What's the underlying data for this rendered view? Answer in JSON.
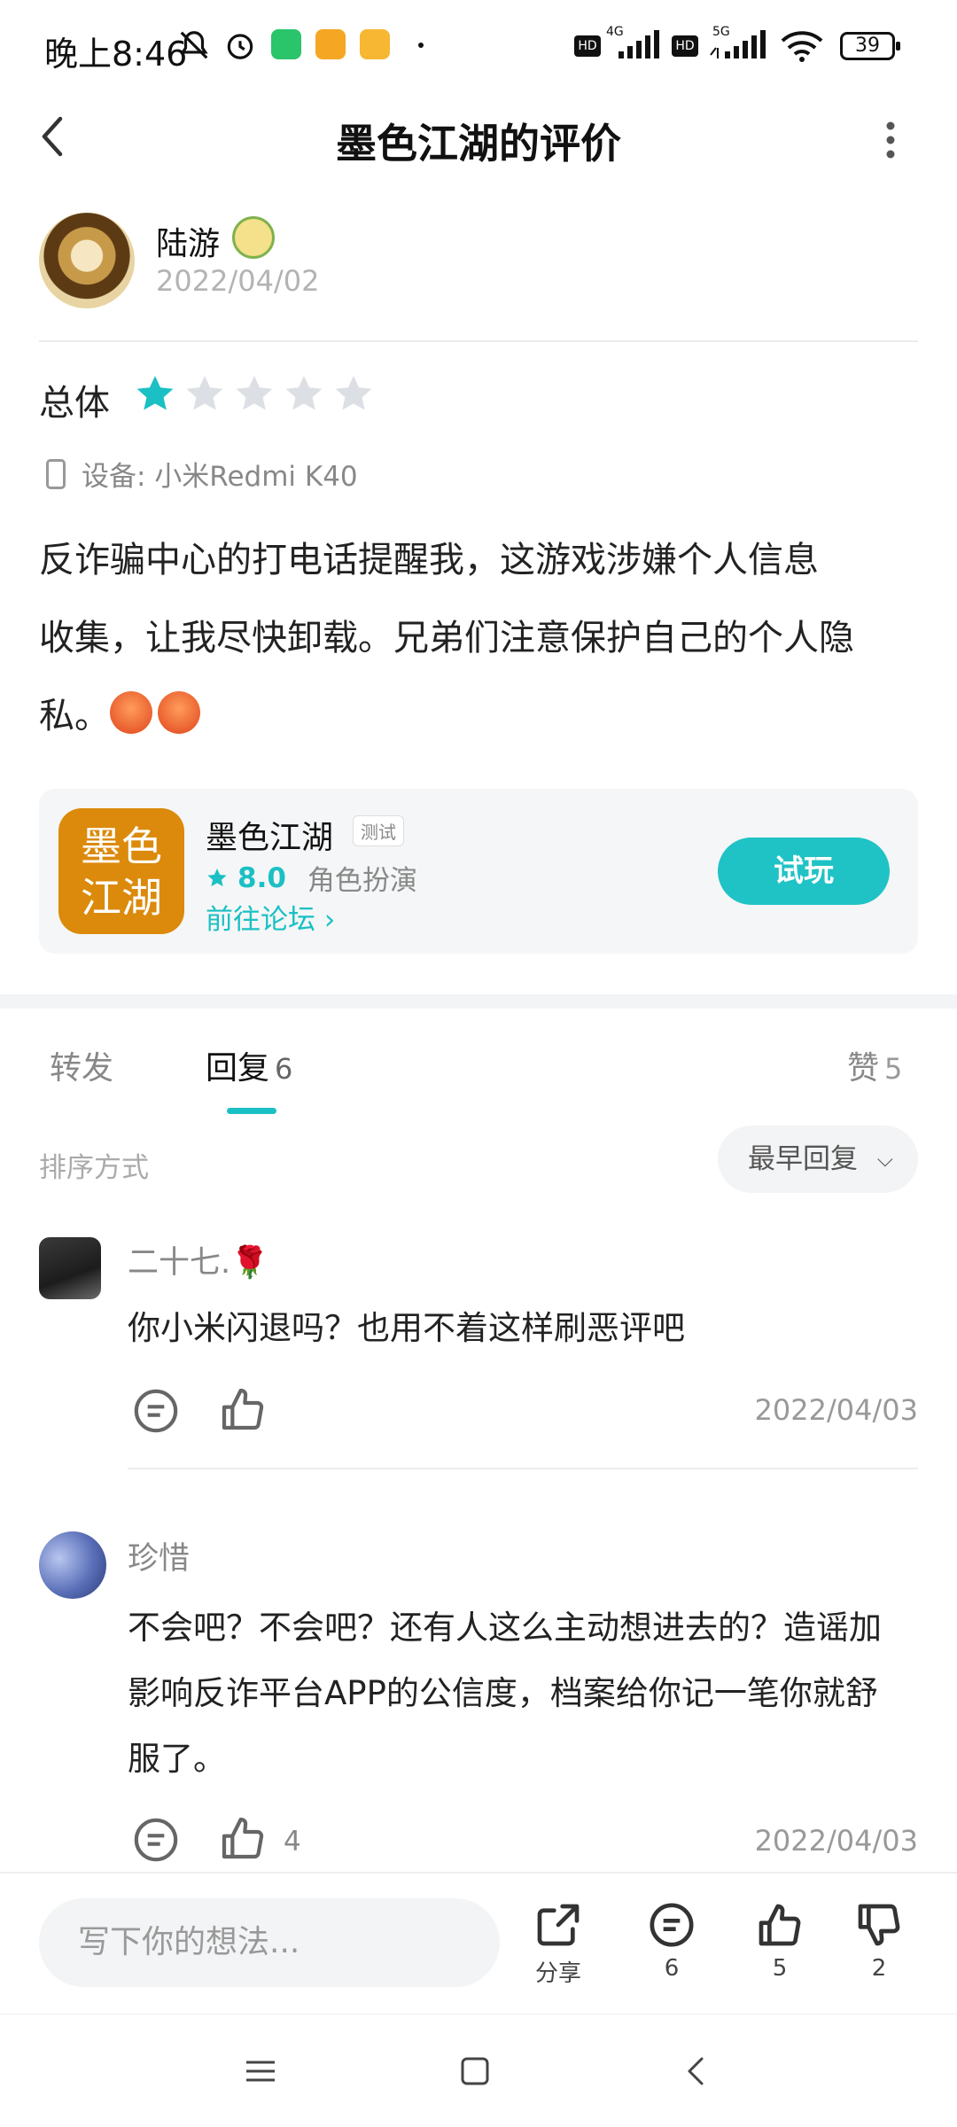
{
  "status_bar": {
    "time": "晚上8:46",
    "network_1": "4G",
    "network_2": "5G",
    "hd": "HD",
    "battery": "39"
  },
  "header": {
    "title": "墨色江湖的评价"
  },
  "review": {
    "username": "陆游",
    "date": "2022/04/02",
    "overall_label": "总体",
    "rating": 1,
    "max_rating": 5,
    "device_label": "设备: 小米Redmi K40",
    "text_line1": "反诈骗中心的打电话提醒我，这游戏涉嫌个人信息",
    "text_line2": "收集，让我尽快卸载。兄弟们注意保护自己的个人隐",
    "text_line3": "私。"
  },
  "app_card": {
    "icon_text_1": "墨色",
    "icon_text_2": "江湖",
    "name": "墨色江湖",
    "tag": "测试",
    "rating": "8.0",
    "genre": "角色扮演",
    "forum_link": "前往论坛",
    "try_button": "试玩",
    "accent_color": "#20c3c5",
    "icon_color": "#db8a0b"
  },
  "tabs": {
    "forward": "转发",
    "reply": "回复",
    "reply_count": "6",
    "like": "赞",
    "like_count": "5"
  },
  "sort": {
    "label": "排序方式",
    "selected": "最早回复"
  },
  "replies": [
    {
      "name": "二十七.🌹",
      "text_lines": [
        "你小米闪退吗？也用不着这样刷恶评吧"
      ],
      "likes": "",
      "date": "2022/04/03"
    },
    {
      "name": "珍惜",
      "text_lines": [
        "不会吧？不会吧？还有人这么主动想进去的？造谣加",
        "影响反诈平台APP的公信度，档案给你记一笔你就舒",
        "服了。"
      ],
      "likes": "4",
      "date": "2022/04/03"
    }
  ],
  "bottom_bar": {
    "input_placeholder": "写下你的想法...",
    "share_label": "分享",
    "comment_count": "6",
    "like_count": "5",
    "dislike_count": "2"
  }
}
